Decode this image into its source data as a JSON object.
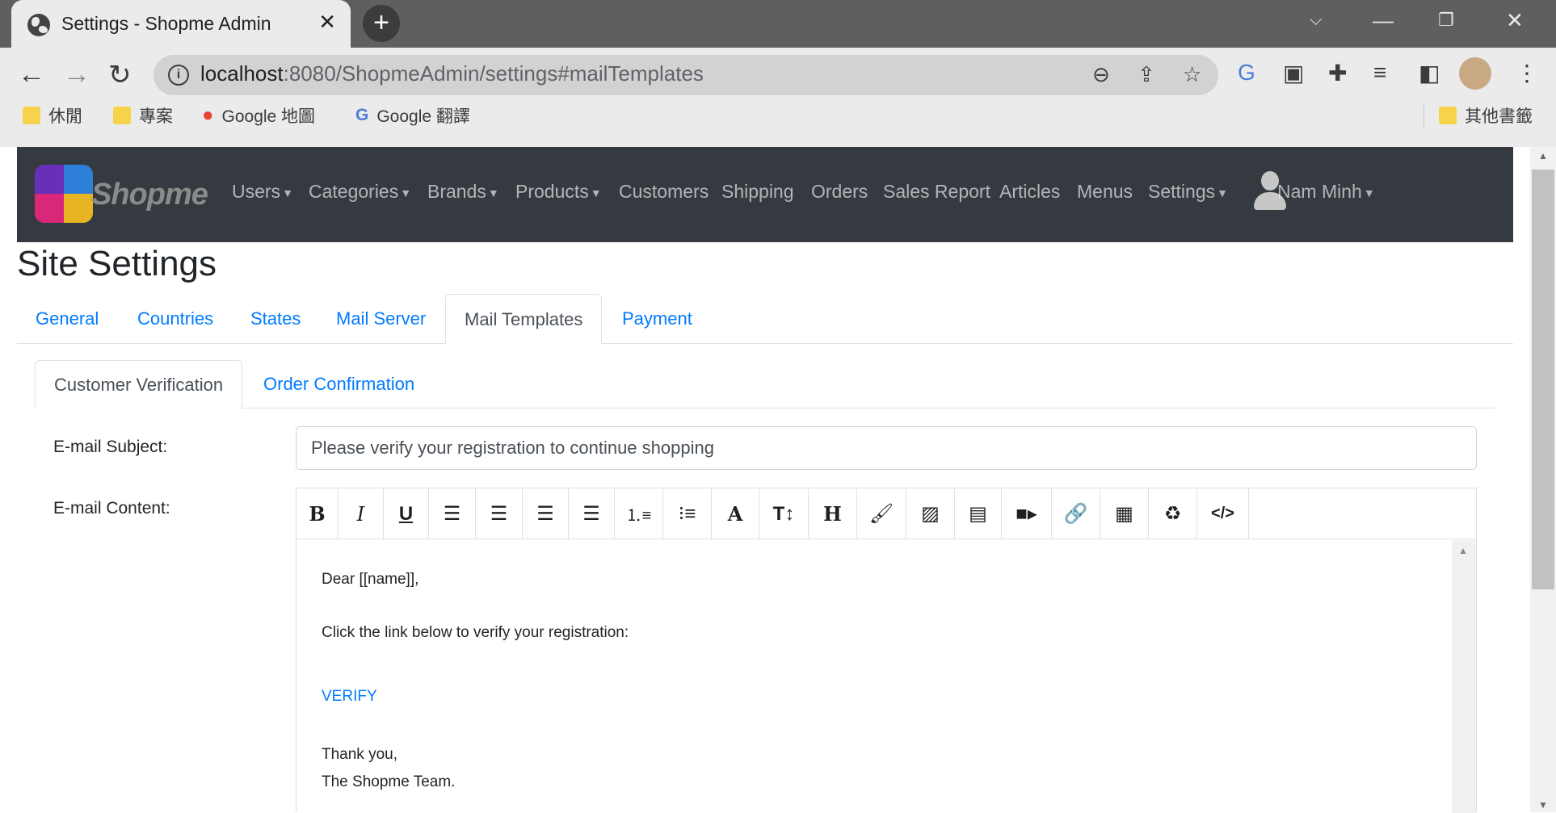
{
  "browser": {
    "tab_title": "Settings - Shopme Admin",
    "tab_close": "✕",
    "url_host": "localhost",
    "url_rest": ":8080/ShopmeAdmin/settings#mailTemplates",
    "bookmarks": [
      {
        "label": "休閒"
      },
      {
        "label": "專案"
      },
      {
        "label": "Google 地圖"
      },
      {
        "label": "Google 翻譯"
      }
    ],
    "other_bookmarks": "其他書籤"
  },
  "navbar": {
    "brand": "Shopme",
    "items": [
      {
        "label": "Users",
        "caret": true
      },
      {
        "label": "Categories",
        "caret": true
      },
      {
        "label": "Brands",
        "caret": true
      },
      {
        "label": "Products",
        "caret": true
      },
      {
        "label": "Customers",
        "caret": false
      },
      {
        "label": "Shipping",
        "caret": false
      },
      {
        "label": "Orders",
        "caret": false
      },
      {
        "label": "Sales Report",
        "caret": false
      },
      {
        "label": "Articles",
        "caret": false
      },
      {
        "label": "Menus",
        "caret": false
      },
      {
        "label": "Settings",
        "caret": true
      }
    ],
    "user": "Nam Minh"
  },
  "page": {
    "title": "Site Settings",
    "tabs": [
      "General",
      "Countries",
      "States",
      "Mail Server",
      "Mail Templates",
      "Payment"
    ],
    "active_tab": "Mail Templates",
    "subtabs": [
      "Customer Verification",
      "Order Confirmation"
    ],
    "active_subtab": "Customer Verification"
  },
  "form": {
    "subject_label": "E-mail Subject:",
    "subject_value": "Please verify your registration to continue shopping",
    "content_label": "E-mail Content:",
    "content_lines": {
      "greeting": "Dear [[name]],",
      "instruction": "Click the link below to verify your registration:",
      "link": "VERIFY",
      "thanks": "Thank you,",
      "signature": "The Shopme Team."
    }
  },
  "editor_toolbar": [
    "bold-icon",
    "italic-icon",
    "underline-icon",
    "align-left-icon",
    "align-center-icon",
    "align-right-icon",
    "justify-icon",
    "ordered-list-icon",
    "unordered-list-icon",
    "font-icon",
    "text-height-icon",
    "heading-icon",
    "paint-brush-icon",
    "image-icon",
    "file-icon",
    "video-icon",
    "link-icon",
    "table-icon",
    "recycle-icon",
    "code-icon"
  ],
  "colors": {
    "navbar_bg": "#343a40",
    "link": "#007bff",
    "chrome_tabstrip": "#5f5f5f",
    "chrome_toolbar": "#ebebeb"
  }
}
